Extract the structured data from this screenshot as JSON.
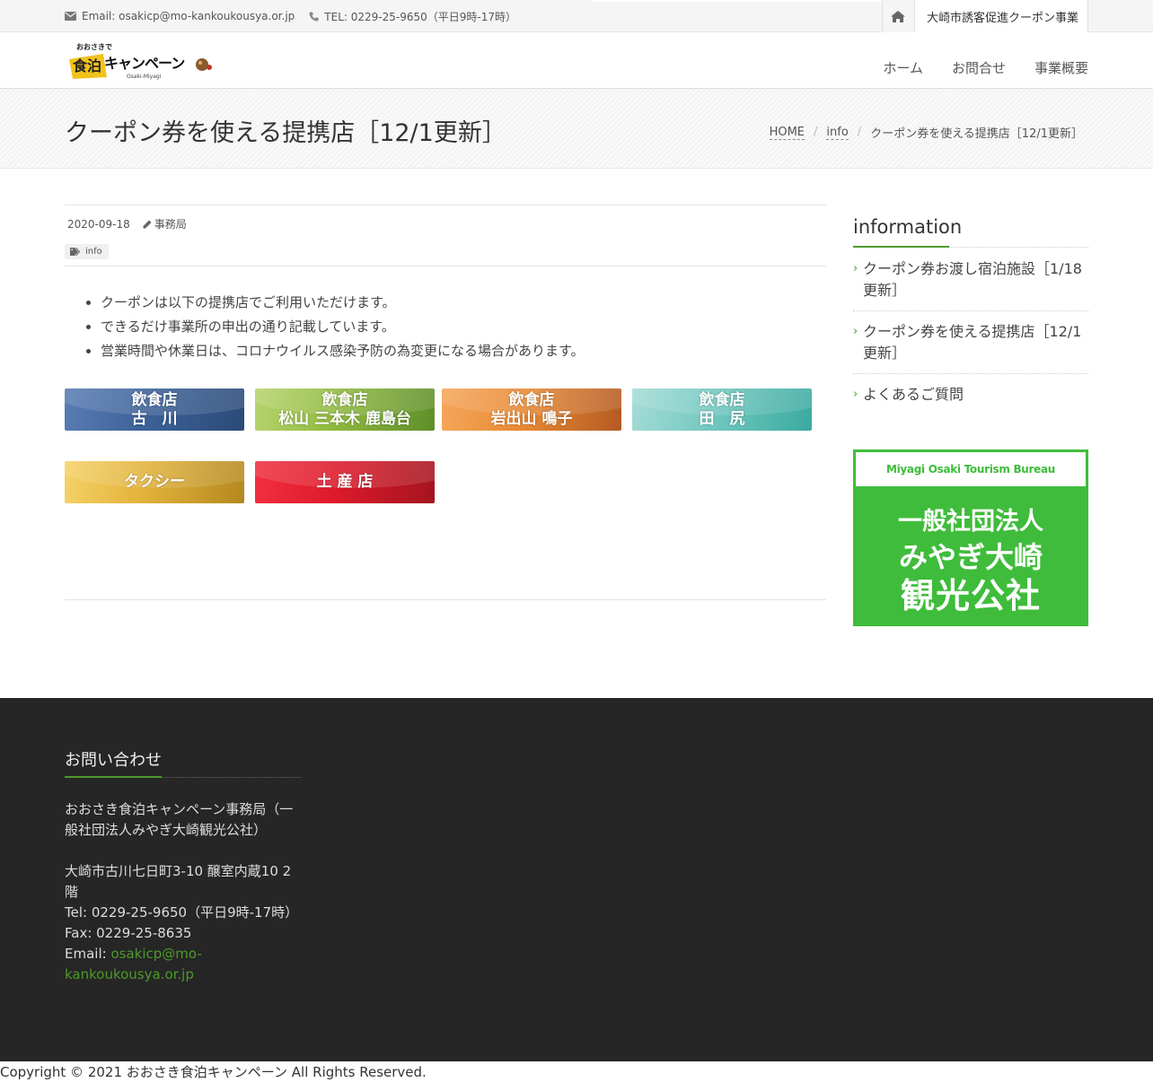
{
  "topbar": {
    "email": "Email: osakicp@mo-kankoukousya.or.jp",
    "tel": "TEL: 0229-25-9650（平日9時-17時）",
    "project_link": "大崎市誘客促進クーポン事業"
  },
  "header": {
    "logo_small": "おおさきで",
    "logo_main_1": "食泊",
    "logo_main_2": "キャンペーン",
    "logo_sub": "Osaki-Miyagi",
    "nav": [
      "ホーム",
      "お問合せ",
      "事業概要"
    ]
  },
  "titlebar": {
    "title": "クーポン券を使える提携店［12/1更新］",
    "breadcrumb": [
      "HOME",
      "info",
      "クーポン券を使える提携店［12/1更新］"
    ]
  },
  "post": {
    "date": "2020-09-18",
    "author": "事務局",
    "tag": "info",
    "bullets": [
      "クーポンは以下の提携店でご利用いただけます。",
      "できるだけ事業所の申出の通り記載しています。",
      "営業時間や休業日は、コロナウイルス感染予防の為変更になる場合があります。"
    ],
    "buttons": [
      {
        "line1": "飲食店",
        "line2": "古　川"
      },
      {
        "line1": "飲食店",
        "line2": "松山 三本木 鹿島台"
      },
      {
        "line1": "飲食店",
        "line2": "岩出山 鳴子"
      },
      {
        "line1": "飲食店",
        "line2": "田　尻"
      },
      {
        "line1": "タクシー",
        "line2": ""
      },
      {
        "line1": "土 産 店",
        "line2": ""
      }
    ]
  },
  "sidebar": {
    "title": "information",
    "items": [
      "クーポン券お渡し宿泊施設［1/18更新］",
      "クーポン券を使える提携店［12/1更新］",
      "よくあるご質問"
    ],
    "banner": {
      "top": "Miyagi Osaki Tourism Bureau",
      "line1": "一般社団法人",
      "line2": "みやぎ大崎",
      "line3": "観光公社"
    }
  },
  "footer": {
    "title": "お問い合わせ",
    "org": "おおさき食泊キャンペーン事務局（一般社団法人みやぎ大崎観光公社）",
    "address": "大崎市古川七日町3-10 醸室内蔵10 2階",
    "tel": "Tel: 0229-25-9650（平日9時-17時）",
    "fax": "Fax: 0229-25-8635",
    "email_label": "Email: ",
    "email": "osakicp@mo-kankoukousya.or.jp"
  },
  "copyright": "Copyright © 2021 おおさき食泊キャンペーン All Rights Reserved.",
  "colors": {
    "accent_green": "#4d9a2a",
    "banner_green": "#3fbc3b",
    "footer_bg": "#262626"
  }
}
